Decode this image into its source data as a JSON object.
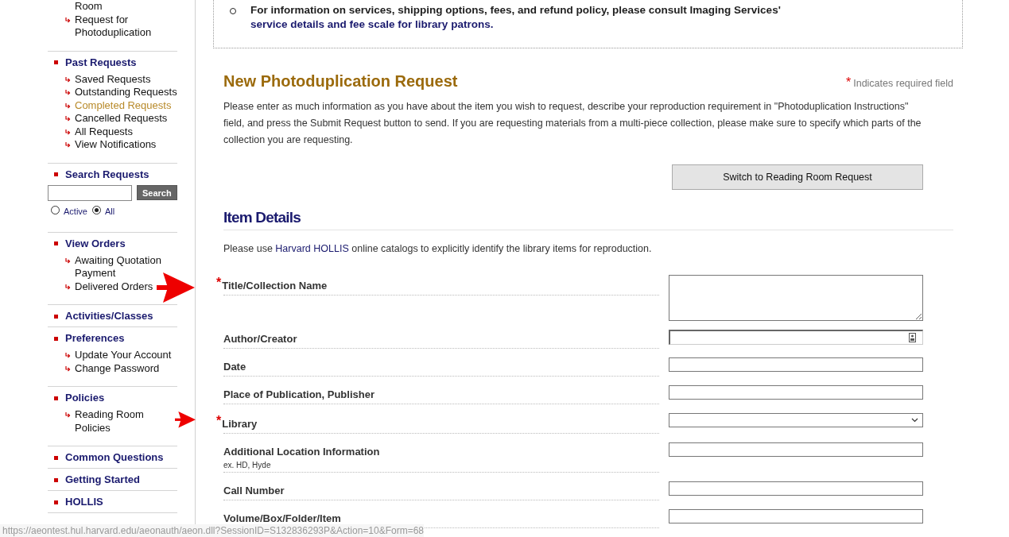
{
  "sidebar": {
    "sections": [
      {
        "items": [
          {
            "label": "Room",
            "kind": "fragment",
            "selected": false
          },
          {
            "label": "Request for Photoduplication",
            "kind": "link",
            "selected": false
          }
        ]
      },
      {
        "title": "Past Requests",
        "items": [
          {
            "label": "Saved Requests",
            "kind": "link",
            "selected": false
          },
          {
            "label": "Outstanding Requests",
            "kind": "link",
            "selected": false
          },
          {
            "label": "Completed Requests",
            "kind": "link",
            "selected": true
          },
          {
            "label": "Cancelled Requests",
            "kind": "link",
            "selected": false
          },
          {
            "label": "All Requests",
            "kind": "link",
            "selected": false
          },
          {
            "label": "View Notifications",
            "kind": "link",
            "selected": false
          }
        ]
      },
      {
        "title": "Search Requests",
        "search": {
          "button": "Search",
          "options": [
            {
              "label": "Active",
              "selected": false
            },
            {
              "label": "All",
              "selected": true
            }
          ]
        }
      },
      {
        "title": "View Orders",
        "items": [
          {
            "label": "Awaiting Quotation Payment",
            "kind": "link",
            "selected": false
          },
          {
            "label": "Delivered Orders",
            "kind": "link",
            "selected": false
          }
        ]
      },
      {
        "title": "Activities/Classes"
      },
      {
        "title": "Preferences",
        "items": [
          {
            "label": "Update Your Account",
            "kind": "link",
            "selected": false
          },
          {
            "label": "Change Password",
            "kind": "link",
            "selected": false
          }
        ]
      },
      {
        "title": "Policies",
        "items": [
          {
            "label": "Reading Room Policies",
            "kind": "link",
            "selected": false
          }
        ]
      },
      {
        "title": "Common Questions"
      },
      {
        "title": "Getting Started"
      },
      {
        "title": "HOLLIS"
      }
    ]
  },
  "notice": {
    "text": "For information on services, shipping options, fees, and refund policy, please consult Imaging Services'",
    "link": "service details and fee scale for library patrons."
  },
  "form": {
    "title": "New Photoduplication Request",
    "required_mark": "*",
    "required_note": "Indicates required field",
    "intro": "Please enter as much information as you have about the item you wish to request, describe your reproduction requirement in \"Photoduplication Instructions\" field, and press the Submit Request button to send. If you are requesting materials from a multi-piece collection, please make sure to specify which parts of the collection you are requesting.",
    "switch_button": "Switch to Reading Room Request",
    "section_title": "Item Details",
    "section_intro": {
      "before": "Please use",
      "link": "Harvard HOLLIS",
      "after": "online catalogs to explicitly identify the library items for reproduction."
    },
    "fields": [
      {
        "label": "Title/Collection Name",
        "kind": "textarea",
        "required": true
      },
      {
        "label": "Author/Creator",
        "kind": "contact",
        "required": false
      },
      {
        "label": "Date",
        "kind": "text",
        "required": false
      },
      {
        "label": "Place of Publication, Publisher",
        "kind": "text",
        "required": false
      },
      {
        "label": "Library",
        "kind": "select",
        "required": true
      },
      {
        "label": "Additional Location Information",
        "hint": "ex. HD, Hyde",
        "kind": "text",
        "required": false
      },
      {
        "label": "Call Number",
        "kind": "text",
        "required": false
      },
      {
        "label": "Volume/Box/Folder/Item",
        "kind": "text",
        "required": false
      }
    ]
  },
  "status_bar": {
    "url": "https://aeontest.hul.harvard.edu/aeonauth/aeon.dll?SessionID=S132836293P&Action=10&Form=68"
  }
}
